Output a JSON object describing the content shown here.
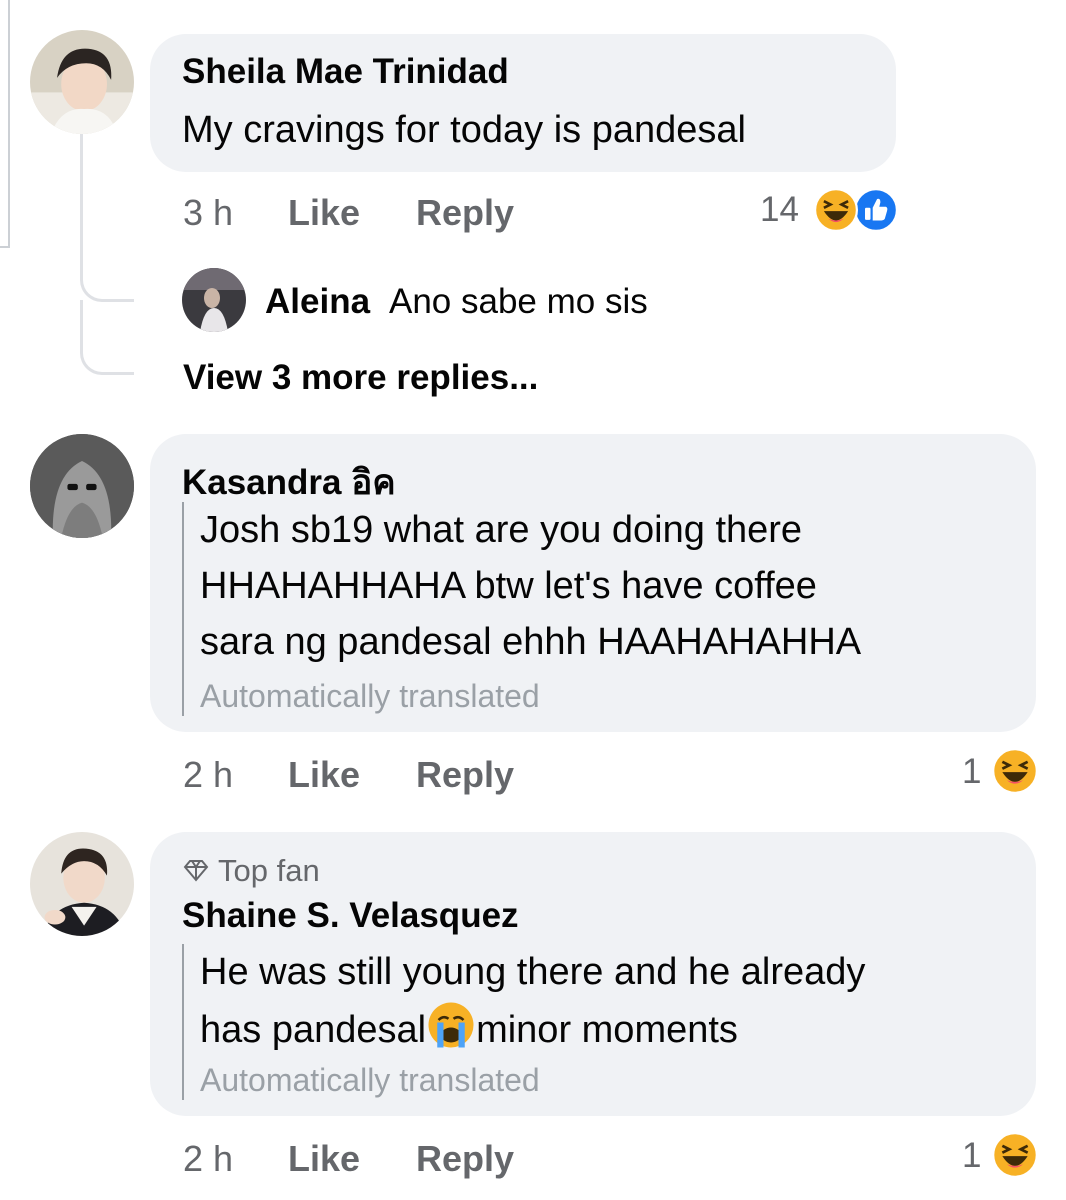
{
  "colors": {
    "bubble": "#f0f2f5",
    "meta_text": "#65676b",
    "translated": "#9aa0a6",
    "like_blue": "#1877f2",
    "haha_yellow": "#f7b125"
  },
  "comments": [
    {
      "author": "Sheila Mae Trinidad",
      "text": "My cravings for today is pandesal",
      "time": "3 h",
      "like_label": "Like",
      "reply_label": "Reply",
      "reaction_count": "14",
      "reactions": [
        "haha-icon",
        "like-icon"
      ],
      "reply": {
        "author": "Aleina",
        "text": "Ano sabe mo sis"
      },
      "more_replies": "View 3 more replies..."
    },
    {
      "author": "Kasandra อิค",
      "lines": [
        "Josh sb19 what are you doing there",
        "HHAHAHHAHA btw let's have coffee",
        "sara ng pandesal ehhh HAAHAHAHHA"
      ],
      "translated": "Automatically translated",
      "time": "2 h",
      "like_label": "Like",
      "reply_label": "Reply",
      "reaction_count": "1",
      "reactions": [
        "haha-icon"
      ]
    },
    {
      "badge": "Top fan",
      "author": "Shaine S. Velasquez",
      "line1": "He was still young there and he already",
      "line2_before": "has pandesal",
      "line2_after": "minor moments",
      "translated": "Automatically translated",
      "time": "2 h",
      "like_label": "Like",
      "reply_label": "Reply",
      "reaction_count": "1",
      "reactions": [
        "haha-icon"
      ]
    }
  ]
}
